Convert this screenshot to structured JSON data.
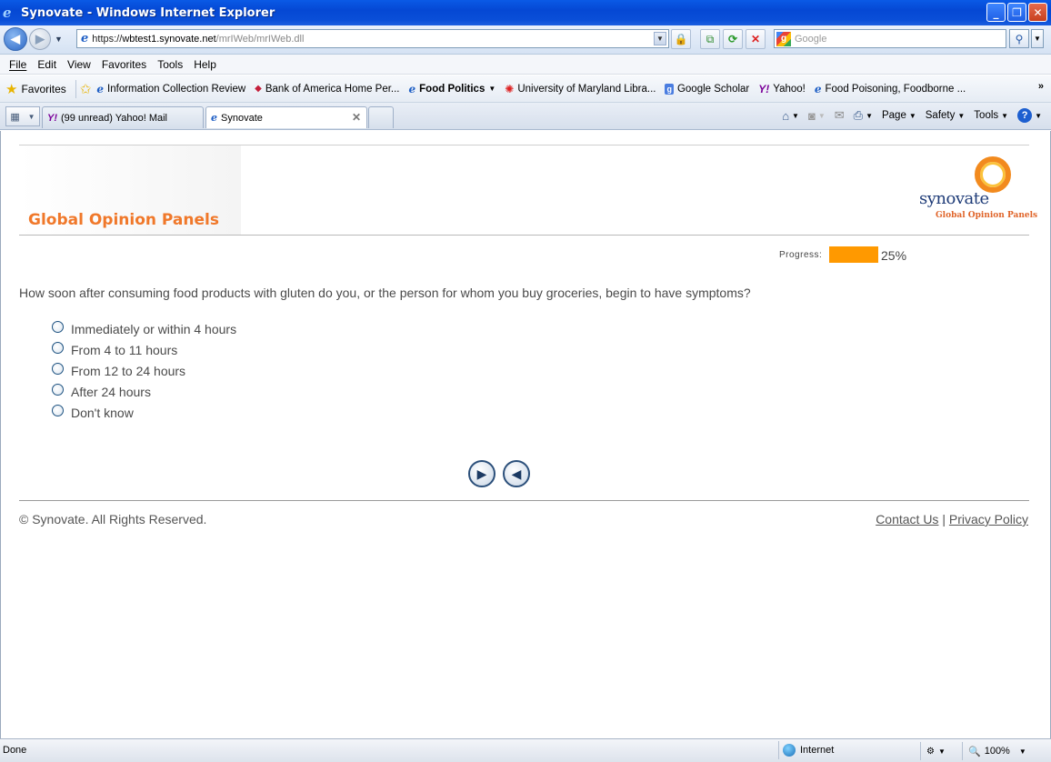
{
  "window": {
    "title": "Synovate - Windows Internet Explorer",
    "controls": [
      "minimize",
      "restore",
      "close"
    ]
  },
  "address_bar": {
    "url_scheme": "https://",
    "url_domain": "wbtest1.synovate.net",
    "url_path": "/mrIWeb/mrIWeb.dll",
    "search_placeholder": "Google"
  },
  "menu": [
    {
      "label": "File",
      "access_key": "F"
    },
    {
      "label": "Edit",
      "access_key": "E"
    },
    {
      "label": "View",
      "access_key": "V"
    },
    {
      "label": "Favorites",
      "access_key": "a"
    },
    {
      "label": "Tools",
      "access_key": "T"
    },
    {
      "label": "Help",
      "access_key": "H"
    }
  ],
  "favorites_bar": {
    "favorites_label": "Favorites",
    "links": [
      {
        "label": "Information Collection Review",
        "icon": "ie-page-icon"
      },
      {
        "label": "Bank of America  Home  Per...",
        "icon": "bank-of-america-icon"
      },
      {
        "label": "Food Politics",
        "icon": "ie-page-icon",
        "bold": true,
        "dropdown": true
      },
      {
        "label": "University of Maryland Libra...",
        "icon": "umd-icon"
      },
      {
        "label": "Google Scholar",
        "icon": "google-scholar-icon"
      },
      {
        "label": "Yahoo!",
        "icon": "yahoo-icon"
      },
      {
        "label": "Food Poisoning, Foodborne ...",
        "icon": "ie-page-icon"
      }
    ]
  },
  "tabs": [
    {
      "label": "(99 unread) Yahoo! Mail",
      "icon": "yahoo-icon",
      "active": false
    },
    {
      "label": "Synovate",
      "icon": "ie-page-icon",
      "active": true
    }
  ],
  "command_bar": {
    "page": "Page",
    "safety": "Safety",
    "tools": "Tools"
  },
  "page": {
    "brand_title": "Global Opinion Panels",
    "logo_word": "synovate",
    "logo_sub": "Global Opinion Panels",
    "progress_label": "Progress:",
    "progress_value": 0.25,
    "progress_text": "25%",
    "question": "How soon after consuming food products with gluten do you, or the person for whom you buy groceries, begin to have symptoms?",
    "options": [
      "Immediately or within 4 hours",
      "From 4 to 11 hours",
      "From 12 to 24 hours",
      "After 24 hours",
      "Don't know"
    ],
    "copyright": "© Synovate. All Rights Reserved.",
    "contact_link": "Contact Us",
    "privacy_link": "Privacy Policy",
    "footer_separator": "|"
  },
  "status_bar": {
    "status": "Done",
    "zone": "Internet",
    "zoom": "100%"
  },
  "colors": {
    "accent_orange": "#f0782a",
    "progress_fill": "#ff9900",
    "titlebar_blue": "#0548d4"
  }
}
